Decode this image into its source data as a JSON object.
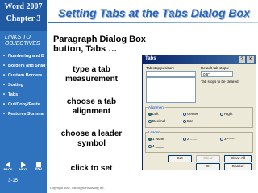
{
  "brand": {
    "line1": "Word 2007",
    "line2": "Chapter 3"
  },
  "sidebar": {
    "links_title": "LINKS TO OBJECTIVES",
    "items": [
      {
        "label": "Numbering and B"
      },
      {
        "label": "Borders and Shad"
      },
      {
        "label": "Custom Borders"
      },
      {
        "label": "Sorting"
      },
      {
        "label": "Tabs"
      },
      {
        "label": "Cut/Copy/Paste"
      },
      {
        "label": "Features Summar"
      }
    ],
    "nav": {
      "back": "BACK",
      "next": "NEXT",
      "end": "END"
    },
    "slide_number": "3-15"
  },
  "slide": {
    "title": "Setting Tabs at the Tabs Dialog Box",
    "subtitle": "Paragraph Dialog Box button, Tabs …",
    "callouts": {
      "c1": "type a tab measurement",
      "c2": "choose a tab alignment",
      "c3": "choose a leader symbol",
      "c4": "click to set"
    },
    "copyright": "Copyright 2007, Paradigm Publishing Inc."
  },
  "dialog": {
    "title": "Tabs",
    "help_symbol": "?",
    "close_symbol": "X",
    "tab_stop_label": "Tab stop position:",
    "default_label": "Default tab stops:",
    "default_value": "0.5\"",
    "clear_label": "Tab stops to be cleared:",
    "alignment_label": "Alignment",
    "alignment_options": [
      "Left",
      "Center",
      "Right",
      "Decimal",
      "Bar"
    ],
    "leader_label": "Leader",
    "leader_options": [
      "1 None",
      "2 .......",
      "3 ------",
      "4 ____"
    ],
    "buttons": {
      "set": "Set",
      "clear": "Clear",
      "clear_all": "Clear All",
      "ok": "OK",
      "cancel": "Cancel"
    }
  }
}
